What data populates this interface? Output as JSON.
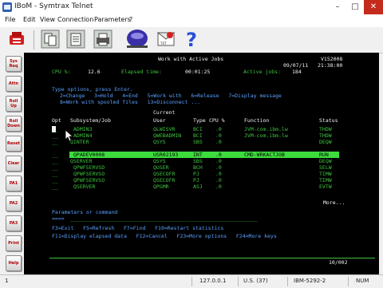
{
  "window": {
    "title": "IBoM - Symtrax Telnet",
    "min": "–",
    "max": "□",
    "close": "✕"
  },
  "menu": [
    "File",
    "Edit",
    "View",
    "Connection",
    "Parameters",
    "?"
  ],
  "side_buttons": [
    "Sys\nReq",
    "Attn",
    "Roll\nUp",
    "Roll\nDown",
    "Reset",
    "Clear",
    "PA1",
    "PA2",
    "PA3",
    "Print",
    "Help"
  ],
  "screen": {
    "title": "Work with Active Jobs",
    "system": "V152008",
    "date": "09/07/11",
    "time": "21:38:00",
    "cpu_label": "CPU %:",
    "cpu_value": "12.6",
    "elapsed_label": "Elapsed time:",
    "elapsed_value": "00:01:25",
    "active_label": "Active jobs:",
    "active_value": "184",
    "type_options": "Type options, press Enter.",
    "options_line1": "2=Change   3=Hold   4=End   5=Work with   6=Release   7=Display message",
    "options_line2": "8=Work with spooled files   13=Disconnect ...",
    "header_current": "Current",
    "headers": [
      "Opt",
      "Subsystem/Job",
      "User",
      "Type",
      "CPU %",
      "Function",
      "Status"
    ],
    "rows": [
      {
        "job": "ADMIN3",
        "user": "QLWISVR",
        "type": "BCI",
        "cpu": ".0",
        "func": "JVM-com.ibm.lw",
        "status": "THDW"
      },
      {
        "job": "ADMIN4",
        "user": "QWEBADMIN",
        "type": "BCI",
        "cpu": ".0",
        "func": "JVM-com.ibm.lw",
        "status": "THDW"
      },
      {
        "job": "QINTER",
        "user": "QSYS",
        "type": "SBS",
        "cpu": ".0",
        "func": "",
        "status": "DEQW"
      },
      {
        "job": "QPADEV0008",
        "user": "USR02193",
        "type": "INT",
        "cpu": ".0",
        "func": "CMD-WRKACTJOB",
        "status": "RUN"
      },
      {
        "job": "QSERVER",
        "user": "QSYS",
        "type": "SBS",
        "cpu": ".0",
        "func": "",
        "status": "DEQW"
      },
      {
        "job": "QPWFSERVSD",
        "user": "QUSER",
        "type": "BCH",
        "cpu": ".0",
        "func": "",
        "status": "SELW"
      },
      {
        "job": "QPWFSERVSO",
        "user": "QSECOFR",
        "type": "PJ",
        "cpu": ".0",
        "func": "",
        "status": "TIMW"
      },
      {
        "job": "QPWFSERVSO",
        "user": "QSECOFR",
        "type": "PJ",
        "cpu": ".0",
        "func": "",
        "status": "TIMW"
      },
      {
        "job": "QSERVER",
        "user": "QPGMR",
        "type": "ASJ",
        "cpu": ".0",
        "func": "",
        "status": "EVTW"
      }
    ],
    "more": "More...",
    "params_label": "Parameters or command",
    "prompt": "===>",
    "fkeys1": "F3=Exit   F5=Refresh   F7=Find   F10=Restart statistics",
    "fkeys2": "F11=Display elapsed data   F12=Cancel   F23=More options   F24=More keys",
    "position": "10/002"
  },
  "status": {
    "field1": "1",
    "ip": "127.0.0.1",
    "country": "U.S. (37)",
    "codepage": "IBM-5292-2",
    "mode": "NUM"
  },
  "colors": {
    "terminal_bg": "#000000",
    "terminal_text": "#3ec43e",
    "highlight_bar": "#3ddc3d",
    "close_button": "#c42b1c"
  }
}
